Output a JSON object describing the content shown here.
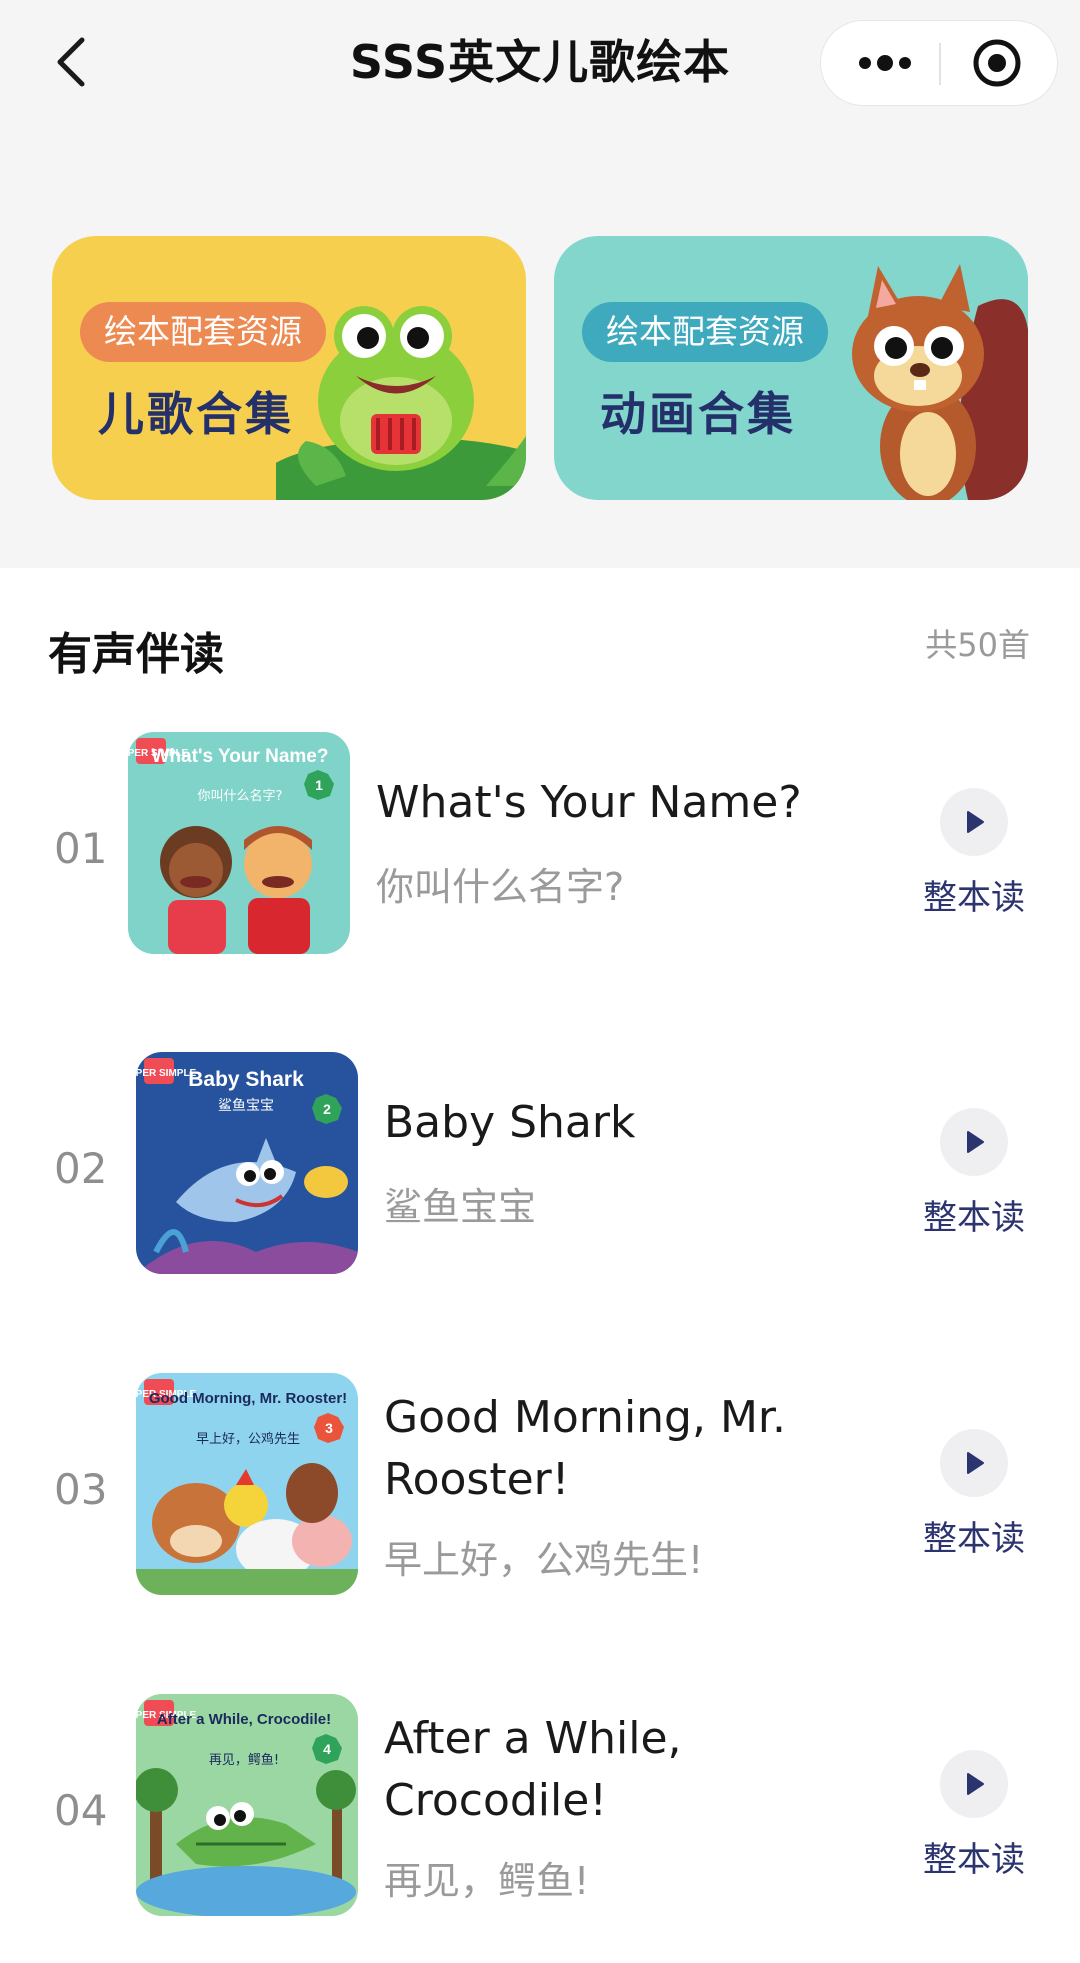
{
  "nav": {
    "title": "SSS英文儿歌绘本",
    "back_icon": "chevron-left-icon",
    "more_icon": "more-dots-icon",
    "close_icon": "target-circle-icon"
  },
  "banners": [
    {
      "tag": "绘本配套资源",
      "title": "儿歌合集",
      "bg": "#f7cf4f",
      "tag_bg": "#ec8a52",
      "icon": "frog-illustration"
    },
    {
      "tag": "绘本配套资源",
      "title": "动画合集",
      "bg": "#82d6cc",
      "tag_bg": "#3fa9bd",
      "icon": "squirrel-illustration"
    }
  ],
  "section": {
    "title": "有声伴读",
    "count": "共50首"
  },
  "items": [
    {
      "num": "01",
      "title_en": "What's Your Name?",
      "title_zh": "你叫什么名字?",
      "read_label": "整本读",
      "cover": {
        "brand": "SUPER SIMPLE",
        "heading": "What's Your Name?",
        "sub": "你叫什么名字?",
        "badge": "1",
        "bg": "#7fd3c8"
      }
    },
    {
      "num": "02",
      "title_en": "Baby Shark",
      "title_zh": "鲨鱼宝宝",
      "read_label": "整本读",
      "cover": {
        "brand": "SUPER SIMPLE",
        "heading": "Baby Shark",
        "sub": "鲨鱼宝宝",
        "badge": "2",
        "bg": "#27539e"
      }
    },
    {
      "num": "03",
      "title_en": "Good Morning, Mr. Rooster!",
      "title_zh": "早上好，公鸡先生!",
      "read_label": "整本读",
      "cover": {
        "brand": "SUPER SIMPLE",
        "heading": "Good Morning, Mr. Rooster!",
        "sub": "早上好，公鸡先生",
        "badge": "3",
        "bg": "#8fd4ef"
      }
    },
    {
      "num": "04",
      "title_en": "After a While, Crocodile!",
      "title_zh": "再见，鳄鱼!",
      "read_label": "整本读",
      "cover": {
        "brand": "SUPER SIMPLE",
        "heading": "After a While, Crocodile!",
        "sub": "再见，鳄鱼!",
        "badge": "4",
        "bg": "#9ad7a3"
      }
    }
  ]
}
